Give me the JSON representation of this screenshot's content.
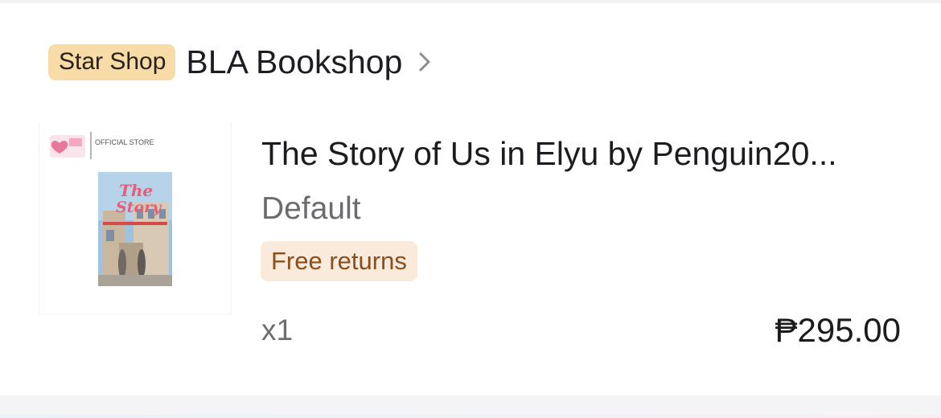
{
  "shop": {
    "badge": "Star Shop",
    "name": "BLA Bookshop",
    "chevron_icon": "chevron-right-icon"
  },
  "product": {
    "image_icon": "book-cover-thumbnail",
    "image_store_label": "OFFICIAL STORE",
    "image_cover_title": "The Story of Us in Elyu",
    "title": "The Story of Us in Elyu by Penguin20...",
    "variant": "Default",
    "returns_badge": "Free returns",
    "quantity": "x1",
    "price": "₱295.00"
  },
  "colors": {
    "shop_badge_bg": "#f8dca8",
    "returns_badge_bg": "#faeadc",
    "returns_badge_text": "#8a4f1c",
    "secondary_text": "#6b6b70"
  }
}
